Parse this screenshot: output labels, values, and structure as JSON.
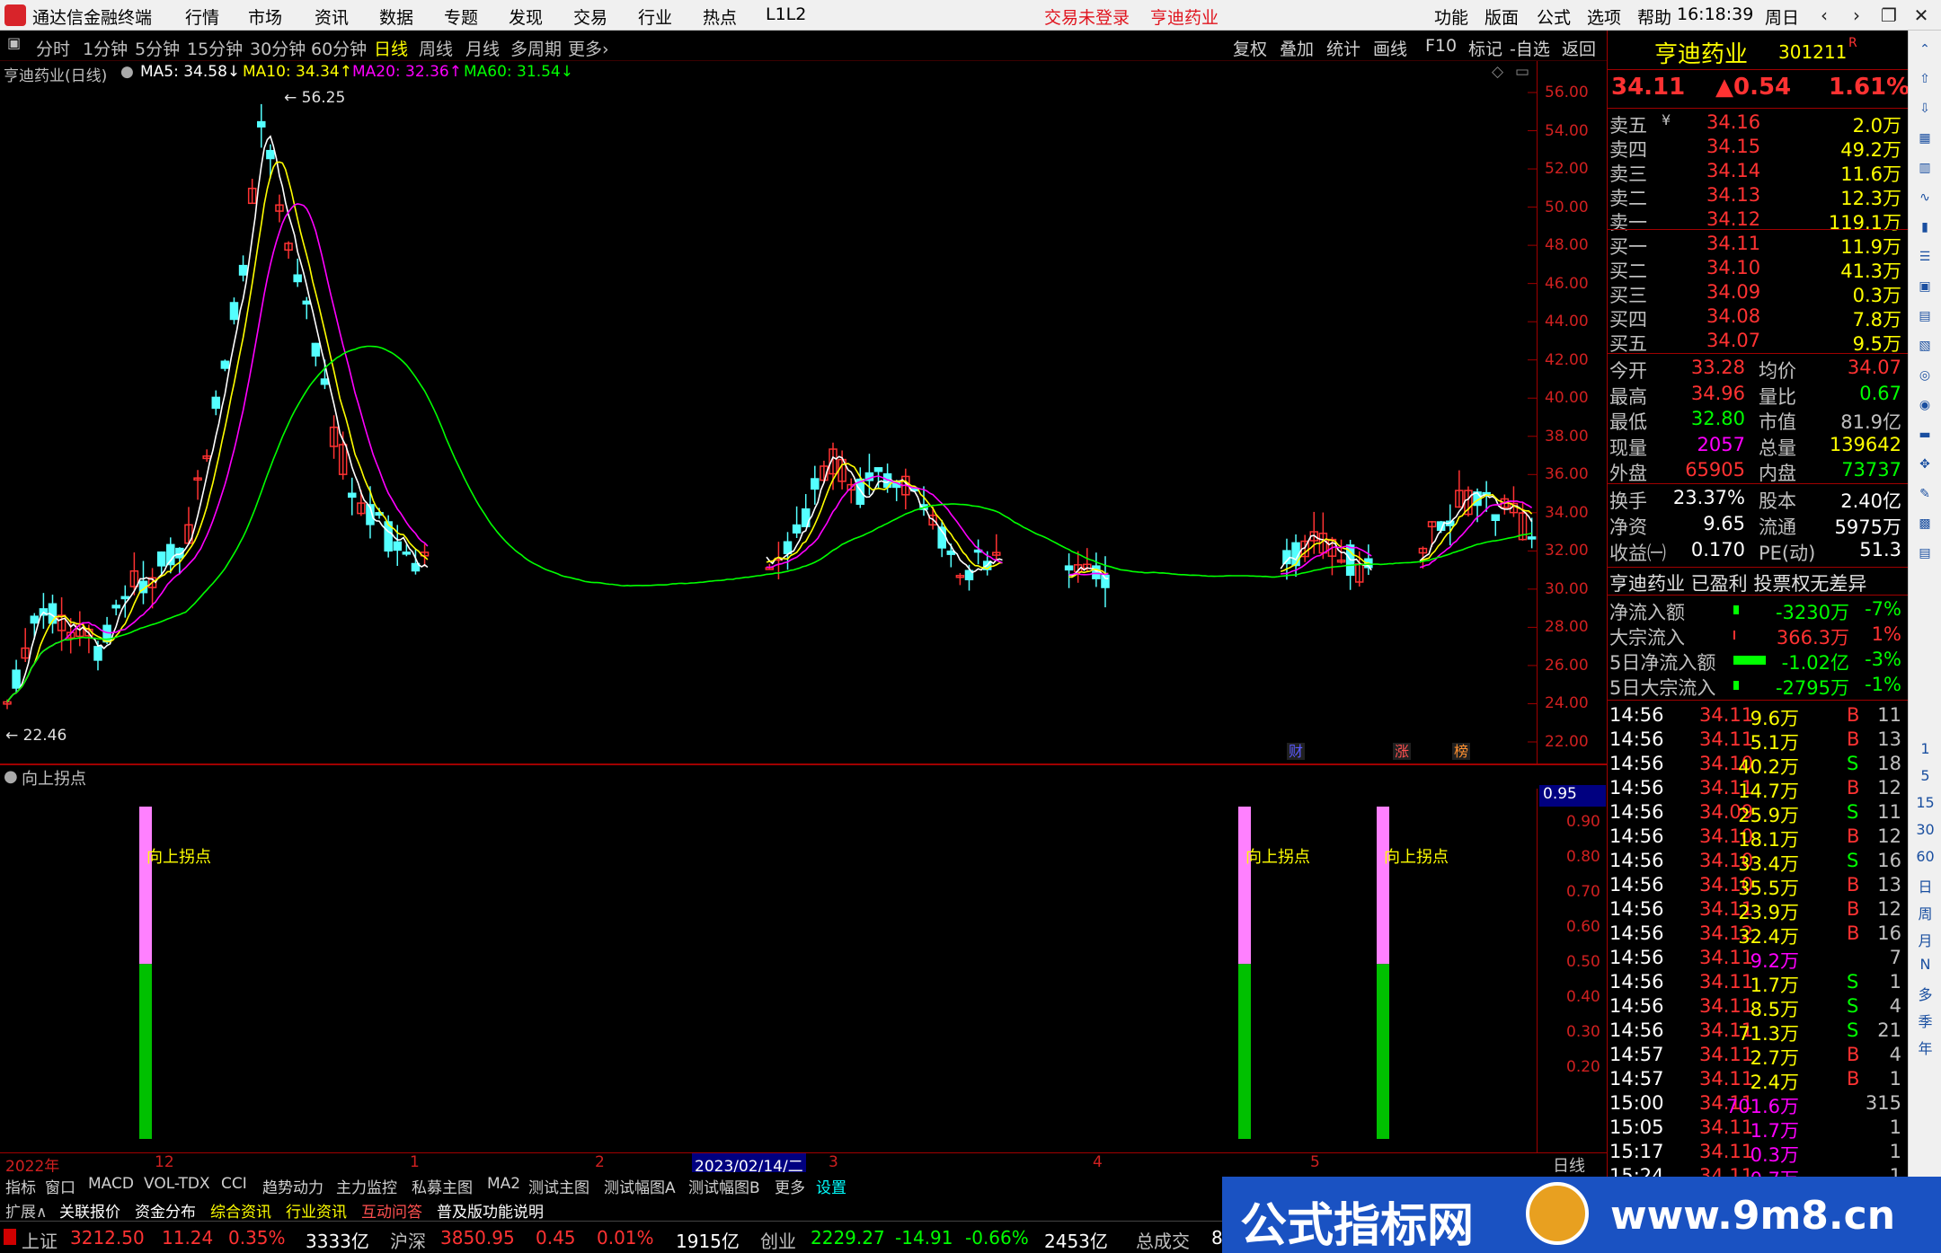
{
  "titlebar": {
    "app_name": "通达信金融终端",
    "menus": [
      "行情",
      "市场",
      "资讯",
      "数据",
      "专题",
      "发现",
      "交易",
      "行业",
      "热点",
      "L1L2"
    ],
    "trade_status": "交易未登录",
    "stock_name": "亨迪药业",
    "right_menus": [
      "功能",
      "版面",
      "公式",
      "选项",
      "帮助"
    ],
    "time": "16:18:39",
    "weekday": "周日",
    "win_buttons": [
      "‹",
      "›",
      "❐",
      "✕"
    ]
  },
  "toolbar": {
    "periods": [
      "分时",
      "1分钟",
      "5分钟",
      "15分钟",
      "30分钟",
      "60分钟",
      "日线",
      "周线",
      "月线",
      "多周期",
      "更多›"
    ],
    "selected": "日线",
    "right_buttons": [
      "复权",
      "叠加",
      "统计",
      "画线",
      "F10",
      "标记",
      "-自选",
      "返回"
    ]
  },
  "mabar": {
    "title": "亨迪药业(日线)",
    "ma5": "MA5: 34.58↓",
    "ma10": "MA10: 34.34↑",
    "ma20": "MA20: 32.36↑",
    "ma60": "MA60: 31.54↓"
  },
  "main_chart": {
    "high_label": "56.25",
    "low_label": "22.46",
    "price_ticks": [
      "56.00",
      "54.00",
      "52.00",
      "50.00",
      "48.00",
      "46.00",
      "44.00",
      "42.00",
      "40.00",
      "38.00",
      "36.00",
      "34.00",
      "32.00",
      "30.00",
      "28.00",
      "26.00",
      "24.00",
      "22.00"
    ],
    "markers": [
      "财",
      "涨",
      "榜"
    ],
    "colors": {
      "up": "#ff3232",
      "down": "#54ffff",
      "ma5": "#ffffff",
      "ma10": "#ffff00",
      "ma20": "#ff00ff",
      "ma60": "#00ff00"
    }
  },
  "sub_chart": {
    "title": "向上拐点",
    "signal_label": "向上拐点",
    "signals": [
      {
        "value": 0.95
      },
      {
        "value": 0.95
      },
      {
        "value": 0.95
      }
    ],
    "current_value": "0.95",
    "ticks": [
      "0.90",
      "0.80",
      "0.70",
      "0.60",
      "0.50",
      "0.40",
      "0.30",
      "0.20"
    ]
  },
  "dateaxis": {
    "labels": [
      "2022年",
      "12",
      "1",
      "2",
      "3",
      "4",
      "5"
    ],
    "highlight": "2023/02/14/二",
    "period": "日线"
  },
  "tabs1": [
    "指标",
    "窗口",
    "MACD",
    "VOL-TDX",
    "CCI",
    "趋势动力",
    "主力监控",
    "私募主图",
    "MA2",
    "测试主图",
    "测试幅图A",
    "测试幅图B",
    "更多",
    "设置"
  ],
  "tabs2": [
    "扩展∧",
    "关联报价",
    "资金分布",
    "综合资讯",
    "行业资讯",
    "互动问答",
    "普及版功能说明"
  ],
  "statusbar": {
    "sh_name": "上证",
    "sh_val": "3212.50",
    "sh_chg": "11.24",
    "sh_pct": "0.35%",
    "sh_amt": "3333亿",
    "hs_name": "沪深",
    "hs_val": "3850.95",
    "hs_chg": "0.45",
    "hs_pct": "0.01%",
    "hs_amt": "1915亿",
    "cy_name": "创业",
    "cy_val": "2229.27",
    "cy_chg": "-14.91",
    "cy_pct": "-0.66%",
    "cy_amt": "2453亿",
    "total": "总成交",
    "total_val": "8"
  },
  "quote": {
    "name": "亨迪药业",
    "code": "301211",
    "tag": "R",
    "price": "34.11",
    "change": "▲0.54",
    "pct": "1.61%",
    "asks": [
      {
        "label": "卖五",
        "mark": "¥",
        "price": "34.16",
        "vol": "2.0万"
      },
      {
        "label": "卖四",
        "mark": "",
        "price": "34.15",
        "vol": "49.2万"
      },
      {
        "label": "卖三",
        "mark": "",
        "price": "34.14",
        "vol": "11.6万"
      },
      {
        "label": "卖二",
        "mark": "",
        "price": "34.13",
        "vol": "12.3万"
      },
      {
        "label": "卖一",
        "mark": "",
        "price": "34.12",
        "vol": "119.1万"
      }
    ],
    "bids": [
      {
        "label": "买一",
        "price": "34.11",
        "vol": "11.9万"
      },
      {
        "label": "买二",
        "price": "34.10",
        "vol": "41.3万"
      },
      {
        "label": "买三",
        "price": "34.09",
        "vol": "0.3万"
      },
      {
        "label": "买四",
        "price": "34.08",
        "vol": "7.8万"
      },
      {
        "label": "买五",
        "price": "34.07",
        "vol": "9.5万"
      }
    ],
    "stats": [
      {
        "l1": "今开",
        "v1": "33.28",
        "c1": "#ff3232",
        "l2": "均价",
        "v2": "34.07",
        "c2": "#ff3232"
      },
      {
        "l1": "最高",
        "v1": "34.96",
        "c1": "#ff3232",
        "l2": "量比",
        "v2": "0.67",
        "c2": "#00ff00"
      },
      {
        "l1": "最低",
        "v1": "32.80",
        "c1": "#00ff00",
        "l2": "市值",
        "v2": "81.9亿",
        "c2": "#c0c0c0"
      },
      {
        "l1": "现量",
        "v1": "2057",
        "c1": "#ff00ff",
        "l2": "总量",
        "v2": "139642",
        "c2": "#ffff00"
      },
      {
        "l1": "外盘",
        "v1": "65905",
        "c1": "#ff3232",
        "l2": "内盘",
        "v2": "73737",
        "c2": "#00ff00"
      }
    ],
    "stats2": [
      {
        "l1": "换手",
        "v1": "23.37%",
        "l2": "股本",
        "v2": "2.40亿"
      },
      {
        "l1": "净资",
        "v1": "9.65",
        "l2": "流通",
        "v2": "5975万"
      },
      {
        "l1": "收益㈠",
        "v1": "0.170",
        "l2": "PE(动)",
        "v2": "51.3"
      }
    ],
    "info_line": "亨迪药业 已盈利 投票权无差异",
    "flows": [
      {
        "label": "净流入额",
        "value": "-3230万",
        "pct": "-7%",
        "vc": "#00ff00",
        "bar": 6
      },
      {
        "label": "大宗流入",
        "value": "366.3万",
        "pct": "1%",
        "vc": "#ff3232",
        "bar": 2
      },
      {
        "label": "5日净流入额",
        "value": "-1.02亿",
        "pct": "-3%",
        "vc": "#00ff00",
        "bar": 36
      },
      {
        "label": "5日大宗流入",
        "value": "-2795万",
        "pct": "-1%",
        "vc": "#00ff00",
        "bar": 6
      }
    ],
    "ticks": [
      {
        "t": "14:56",
        "p": "34.11",
        "v": "9.6万",
        "d": "B",
        "n": "11"
      },
      {
        "t": "14:56",
        "p": "34.11",
        "v": "5.1万",
        "d": "B",
        "n": "13"
      },
      {
        "t": "14:56",
        "p": "34.10",
        "v": "40.2万",
        "d": "S",
        "n": "18"
      },
      {
        "t": "14:56",
        "p": "34.11",
        "v": "14.7万",
        "d": "B",
        "n": "12"
      },
      {
        "t": "14:56",
        "p": "34.09",
        "v": "25.9万",
        "d": "S",
        "n": "11"
      },
      {
        "t": "14:56",
        "p": "34.10",
        "v": "18.1万",
        "d": "B",
        "n": "12"
      },
      {
        "t": "14:56",
        "p": "34.10",
        "v": "33.4万",
        "d": "S",
        "n": "16"
      },
      {
        "t": "14:56",
        "p": "34.10",
        "v": "35.5万",
        "d": "B",
        "n": "13"
      },
      {
        "t": "14:56",
        "p": "34.11",
        "v": "23.9万",
        "d": "B",
        "n": "12"
      },
      {
        "t": "14:56",
        "p": "34.12",
        "v": "32.4万",
        "d": "B",
        "n": "16"
      },
      {
        "t": "14:56",
        "p": "34.11",
        "v": "9.2万",
        "d": "",
        "n": "7"
      },
      {
        "t": "14:56",
        "p": "34.11",
        "v": "1.7万",
        "d": "S",
        "n": "1"
      },
      {
        "t": "14:56",
        "p": "34.11",
        "v": "8.5万",
        "d": "S",
        "n": "4"
      },
      {
        "t": "14:56",
        "p": "34.11",
        "v": "71.3万",
        "d": "S",
        "n": "21"
      },
      {
        "t": "14:57",
        "p": "34.11",
        "v": "2.7万",
        "d": "B",
        "n": "4"
      },
      {
        "t": "14:57",
        "p": "34.11",
        "v": "2.4万",
        "d": "B",
        "n": "1"
      },
      {
        "t": "15:00",
        "p": "34.11",
        "v": "701.6万",
        "d": "",
        "n": "315"
      },
      {
        "t": "15:05",
        "p": "34.11",
        "v": "1.7万",
        "d": "",
        "n": "1"
      },
      {
        "t": "15:17",
        "p": "34.11",
        "v": "0.3万",
        "d": "",
        "n": "1"
      },
      {
        "t": "15:24",
        "p": "34.11",
        "v": "0.7万",
        "d": "",
        "n": "1"
      }
    ]
  },
  "side_labels": [
    "1",
    "5",
    "15",
    "30",
    "60",
    "日",
    "周",
    "月",
    "N",
    "多",
    "季",
    "年"
  ],
  "watermark": {
    "text": "公式指标网",
    "url": "www.9m8.cn"
  }
}
